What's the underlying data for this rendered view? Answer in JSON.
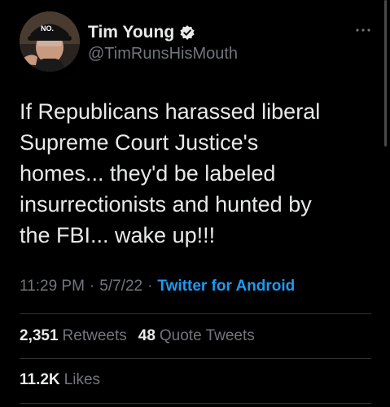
{
  "author": {
    "display_name": "Tim Young",
    "handle": "@TimRunsHisMouth",
    "verified": true,
    "avatar_icon": "profile-photo",
    "hat_text": "NO."
  },
  "tweet": {
    "text": "If Republicans harassed liberal\nSupreme Court Justice's\nhomes... they'd be labeled\ninsurrectionists and hunted by\nthe FBI... wake up!!!",
    "time": "11:29 PM",
    "date": "5/7/22",
    "separator": "·",
    "source": "Twitter for Android"
  },
  "stats": {
    "retweets_count": "2,351",
    "retweets_label": "Retweets",
    "quotes_count": "48",
    "quotes_label": "Quote Tweets",
    "likes_count": "11.2K",
    "likes_label": "Likes"
  },
  "colors": {
    "background": "#000000",
    "text": "#e7e9ea",
    "muted": "#71767b",
    "accent": "#1d9bf0",
    "divider": "#2f3336"
  }
}
